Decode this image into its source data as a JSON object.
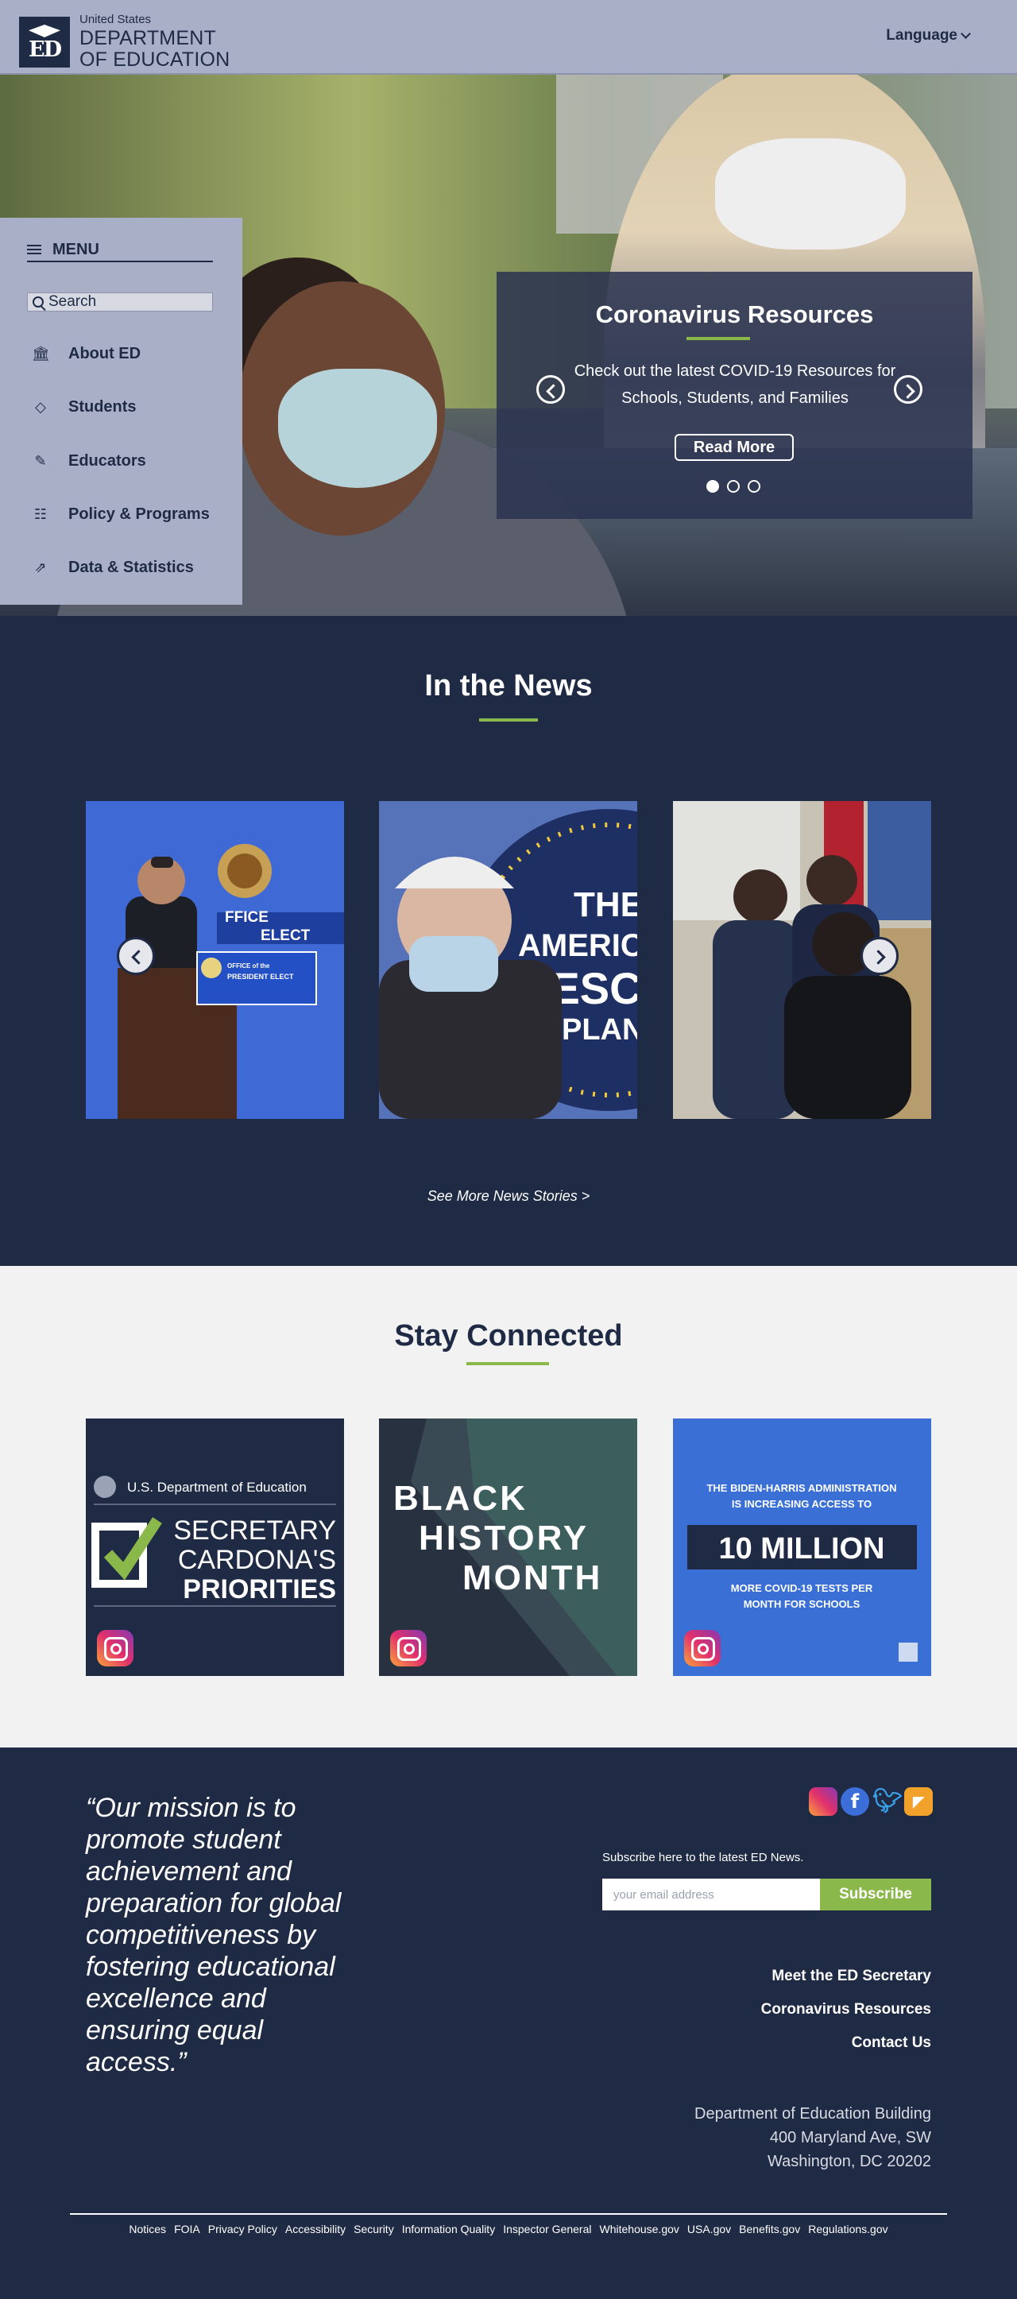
{
  "header": {
    "logo_small": "United States",
    "logo_line1": "DEPARTMENT",
    "logo_line2": "OF EDUCATION",
    "logo_mark_text": "ED",
    "language_label": "Language"
  },
  "menu": {
    "title": "MENU",
    "search_placeholder": "Search",
    "items": [
      {
        "label": "About ED",
        "icon": "institution-icon"
      },
      {
        "label": "Students",
        "icon": "graduation-cap-icon"
      },
      {
        "label": "Educators",
        "icon": "pencil-icon"
      },
      {
        "label": "Policy & Programs",
        "icon": "clipboard-icon"
      },
      {
        "label": "Data & Statistics",
        "icon": "trend-chart-icon"
      }
    ]
  },
  "hero_slide": {
    "title": "Coronavirus Resources",
    "text": "Check out the latest COVID-19 Resources for Schools, Students, and Families",
    "button": "Read More",
    "active_dot": 1,
    "dot_count": 3
  },
  "news": {
    "title": "In the News",
    "cta": "See More News Stories >",
    "card1_sign": "OFFICE OF THE PRESIDENT-ELECT",
    "card1_sign_top": "FFICE",
    "card1_sign_bottom": "ELECT",
    "card1_podium": "PRESIDENT ELECT",
    "card1_podium_top": "OFFICE of the",
    "card2_line1": "THE",
    "card2_line2": "AMERIC",
    "card2_line3": "RESC",
    "card2_line4": "PLAN"
  },
  "stay": {
    "title": "Stay Connected",
    "card1_org": "U.S. Department of Education",
    "card1_line1": "SECRETARY",
    "card1_line2": "CARDONA'S",
    "card1_line3": "PRIORITIES",
    "card2_line1": "BLACK",
    "card2_line2": "HISTORY",
    "card2_line3": "MONTH",
    "card3_line1": "THE BIDEN-HARRIS ADMINISTRATION",
    "card3_line2": "IS INCREASING ACCESS TO",
    "card3_big": "10 MILLION",
    "card3_line3": "MORE COVID-19 TESTS PER",
    "card3_line4": "MONTH FOR SCHOOLS"
  },
  "footer": {
    "quote": "“Our mission is to promote student achievement and preparation for global competitiveness by fostering educational excellence and ensuring equal access.”",
    "subscribe_label": "Subscribe here to the latest ED News.",
    "email_placeholder": "your email address",
    "subscribe_button": "Subscribe",
    "links": [
      "Meet the ED Secretary",
      "Coronavirus Resources",
      "Contact Us"
    ],
    "address": [
      "Department of Education Building",
      "400 Maryland Ave, SW",
      "Washington, DC 20202"
    ],
    "bottom_links": [
      "Notices",
      "FOIA",
      "Privacy Policy",
      "Accessibility",
      "Security",
      "Information Quality",
      "Inspector General",
      "Whitehouse.gov",
      "USA.gov",
      "Benefits.gov",
      "Regulations.gov"
    ],
    "social": [
      "instagram-icon",
      "facebook-icon",
      "twitter-icon",
      "rss-icon"
    ]
  },
  "colors": {
    "navy": "#1f2a44",
    "header_bg": "#a9afc7",
    "accent_green": "#8bb84a",
    "light_bg": "#f2f2f2"
  }
}
